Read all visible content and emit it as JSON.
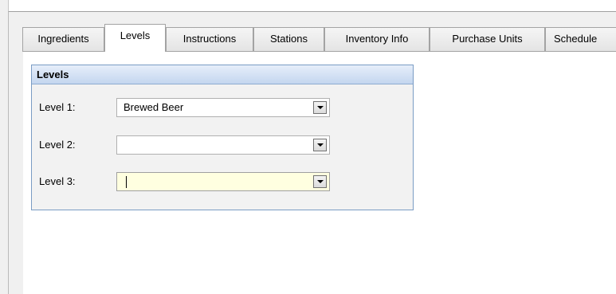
{
  "tabs": [
    {
      "label": "Ingredients"
    },
    {
      "label": "Levels"
    },
    {
      "label": "Instructions"
    },
    {
      "label": "Stations"
    },
    {
      "label": "Inventory Info"
    },
    {
      "label": "Purchase Units"
    },
    {
      "label": "Schedule"
    }
  ],
  "active_tab": "Levels",
  "levels_group": {
    "title": "Levels",
    "rows": [
      {
        "label": "Level 1:",
        "value": "Brewed Beer"
      },
      {
        "label": "Level 2:",
        "value": ""
      },
      {
        "label": "Level 3:",
        "value": ""
      }
    ]
  },
  "colors": {
    "focused_field_bg": "#ffffe0",
    "group_border": "#7a9cc4",
    "group_header_gradient": [
      "#e6eefa",
      "#c4d6ef"
    ]
  }
}
